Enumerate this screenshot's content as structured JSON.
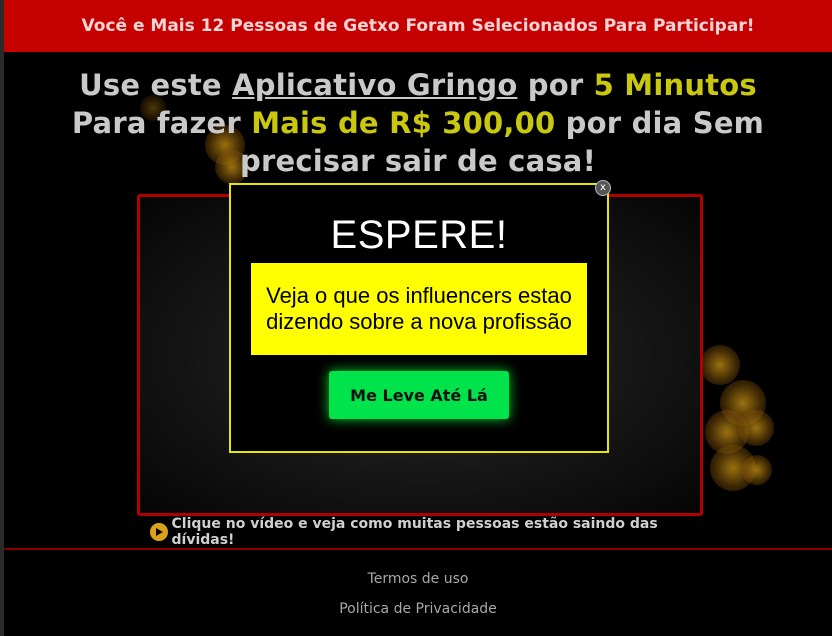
{
  "banner": {
    "text": "Você e Mais 12 Pessoas de Getxo Foram Selecionados Para Participar!"
  },
  "headline": {
    "line1_prefix": "Use este ",
    "line1_link": "Aplicativo Gringo",
    "line1_mid": " por ",
    "line1_highlight": "5 Minutos",
    "line2_prefix": "Para fazer ",
    "line2_highlight": "Mais de R$ 300,00",
    "line2_suffix": " por dia Sem",
    "line3": "precisar sair de casa!"
  },
  "video": {
    "caption": "Clique no vídeo e veja como muitas pessoas estão saindo das dívidas!",
    "play_icon": "play-circle-icon"
  },
  "footer": {
    "terms": "Termos de uso",
    "privacy": "Política de Privacidade"
  },
  "modal": {
    "close_label": "x",
    "title": "ESPERE!",
    "message": "Veja o que os influencers estao dizendo sobre a nova profissão",
    "cta_label": "Me Leve Até Lá"
  },
  "colors": {
    "banner_bg": "#c40000",
    "accent_yellow": "#c9c70e",
    "modal_border": "#e6e600",
    "message_bg": "#ffff00",
    "cta_bg": "#00e34a",
    "frame_border": "#b00000"
  }
}
